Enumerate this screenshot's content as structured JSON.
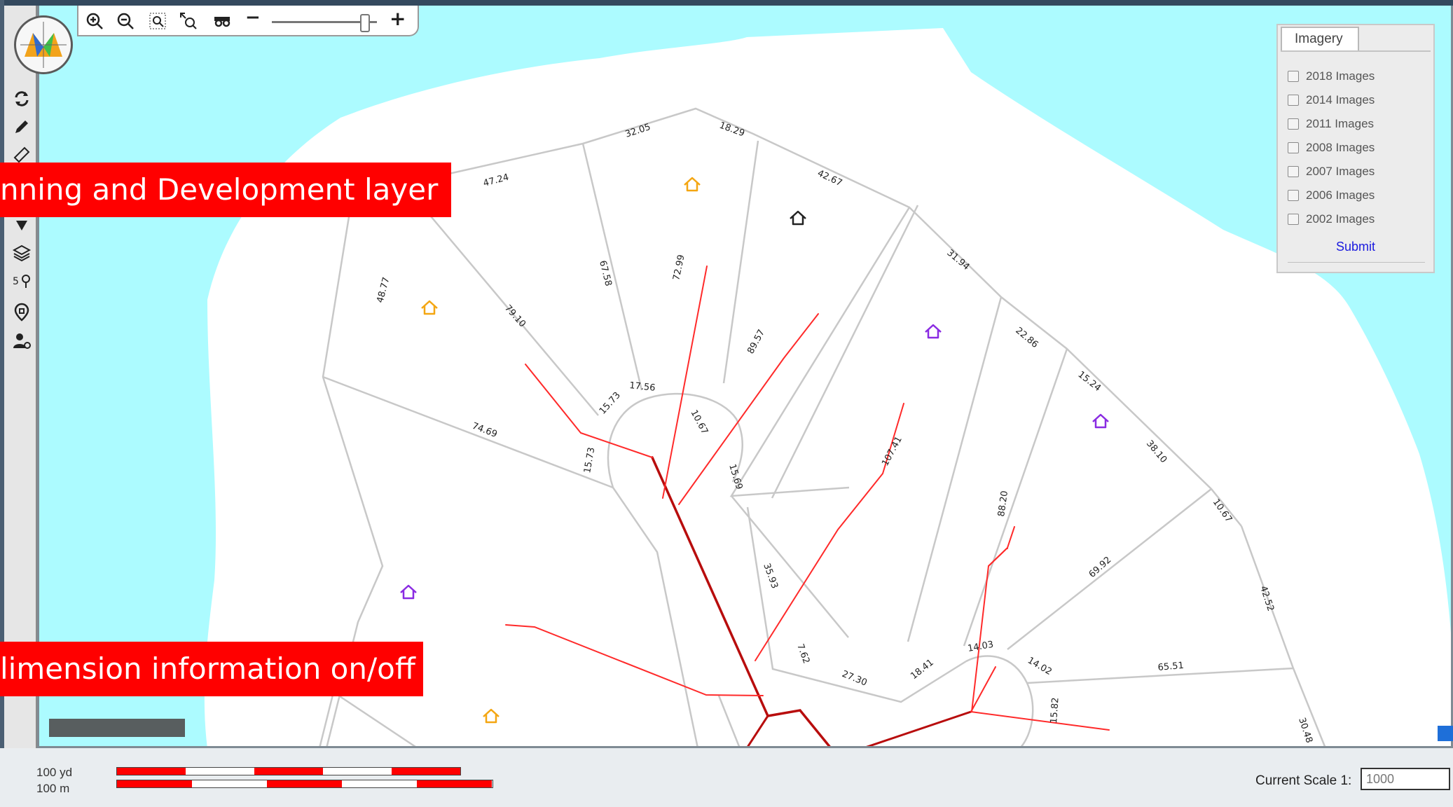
{
  "callouts": {
    "layer": "nning and Development layer",
    "dimension": "limension information on/off"
  },
  "toolbar": {
    "zoom_in_icon": "zoom-in-icon",
    "zoom_out_icon": "zoom-out-icon",
    "zoom_box_icon": "zoom-box-icon",
    "zoom_full_icon": "zoom-full-icon",
    "pan_icon": "pan-binoculars-icon",
    "minus": "−",
    "plus": "+",
    "zoom_level": 0.8
  },
  "left_tools": [
    {
      "icon": "refresh-icon"
    },
    {
      "icon": "pencil-icon"
    },
    {
      "icon": "ruler-icon"
    },
    {
      "icon": "marker-icon"
    },
    {
      "icon": "layers-icon"
    },
    {
      "icon": "route-icon"
    },
    {
      "icon": "location-pin-icon"
    },
    {
      "icon": "user-settings-icon"
    }
  ],
  "imagery": {
    "tab_label": "Imagery",
    "items": [
      {
        "label": "2018 Images",
        "checked": false
      },
      {
        "label": "2014 Images",
        "checked": false
      },
      {
        "label": "2011 Images",
        "checked": false
      },
      {
        "label": "2008 Images",
        "checked": false
      },
      {
        "label": "2007 Images",
        "checked": false
      },
      {
        "label": "2006 Images",
        "checked": false
      },
      {
        "label": "2002 Images",
        "checked": false
      }
    ],
    "submit_label": "Submit"
  },
  "map": {
    "dimension_labels": [
      "32.05",
      "18.29",
      "47.24",
      "42.67",
      "48.77",
      "67.58",
      "72.99",
      "79.10",
      "31.94",
      "89.57",
      "17.56",
      "15.73",
      "10.67",
      "22.86",
      "74.69",
      "15.73",
      "15.69",
      "107.41",
      "15.24",
      "38.10",
      "88.20",
      "10.67",
      "69.92",
      "35.93",
      "42.52",
      "7.62",
      "27.30",
      "18.41",
      "14.03",
      "14.02",
      "65.51",
      "15.82",
      "30.48"
    ],
    "colors": {
      "water": "#acfbff",
      "land": "#ffffff",
      "parcel_line": "#c8c8c8",
      "pipe_main": "#b80d0d",
      "pipe_service": "#ff2a2a",
      "house_orange": "#f4a612",
      "house_purple": "#8a2be2",
      "house_dark": "#222222"
    }
  },
  "footer": {
    "scale_yd": "100 yd",
    "scale_m": "100 m",
    "current_scale_label": "Current Scale 1:",
    "current_scale_value": "1000"
  }
}
